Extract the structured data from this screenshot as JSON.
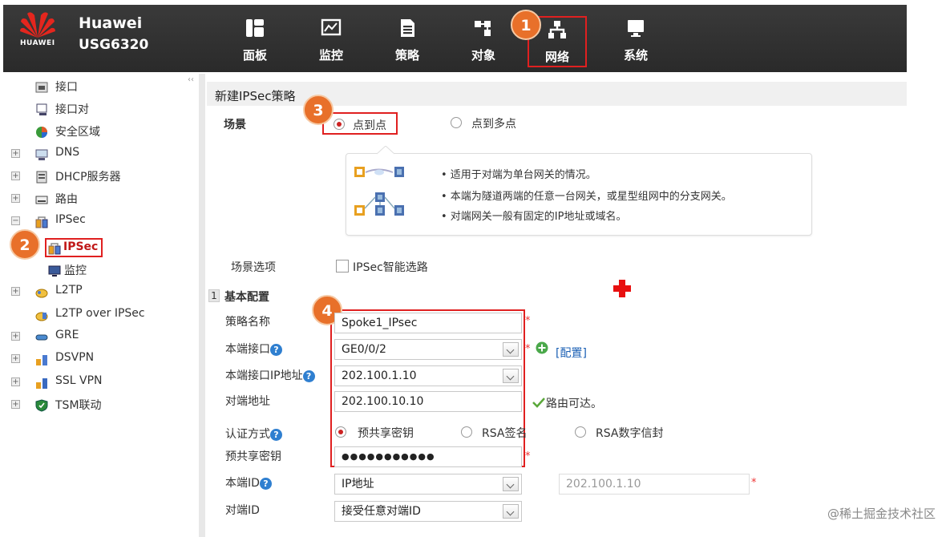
{
  "header": {
    "brand": "Huawei",
    "model": "USG6320",
    "logo_text": "HUAWEI",
    "nav": [
      {
        "label": "面板",
        "icon": "dashboard-icon"
      },
      {
        "label": "监控",
        "icon": "monitor-chart-icon"
      },
      {
        "label": "策略",
        "icon": "policy-document-icon"
      },
      {
        "label": "对象",
        "icon": "object-icon"
      },
      {
        "label": "网络",
        "icon": "network-icon",
        "highlighted": true
      },
      {
        "label": "系统",
        "icon": "system-monitor-icon"
      }
    ]
  },
  "badges": {
    "b1": "1",
    "b2": "2",
    "b3": "3",
    "b4": "4"
  },
  "sidebar": {
    "collapse": "‹‹",
    "items": [
      {
        "label": "接口",
        "icon": "interface-icon"
      },
      {
        "label": "接口对",
        "icon": "interface-pair-icon"
      },
      {
        "label": "安全区域",
        "icon": "security-zone-icon"
      },
      {
        "label": "DNS",
        "icon": "dns-icon",
        "expander": "+"
      },
      {
        "label": "DHCP服务器",
        "icon": "dhcp-server-icon",
        "expander": "+"
      },
      {
        "label": "路由",
        "icon": "router-icon",
        "expander": "+"
      },
      {
        "label": "IPSec",
        "icon": "ipsec-icon",
        "expander": "−"
      },
      {
        "label": "IPSec",
        "icon": "ipsec-icon",
        "selected": true
      },
      {
        "label": "监控",
        "icon": "monitor-icon"
      },
      {
        "label": "L2TP",
        "icon": "l2tp-icon",
        "expander": "+"
      },
      {
        "label": "L2TP over IPSec",
        "icon": "l2tp-ipsec-icon"
      },
      {
        "label": "GRE",
        "icon": "gre-icon",
        "expander": "+"
      },
      {
        "label": "DSVPN",
        "icon": "dsvpn-icon",
        "expander": "+"
      },
      {
        "label": "SSL VPN",
        "icon": "sslvpn-icon",
        "expander": "+"
      },
      {
        "label": "TSM联动",
        "icon": "tsm-shield-icon",
        "expander": "+"
      }
    ]
  },
  "main": {
    "title": "新建IPSec策略",
    "scene": {
      "label": "场景",
      "options": [
        {
          "label": "点到点",
          "selected": true
        },
        {
          "label": "点到多点",
          "selected": false
        }
      ]
    },
    "info": {
      "bullets": [
        "• 适用于对端为单台网关的情况。",
        "• 本端为隧道两端的任意一台网关，或星型组网中的分支网关。",
        "• 对端网关一般有固定的IP地址或域名。"
      ]
    },
    "scene_option": {
      "label": "场景选项",
      "checkbox_label": "IPSec智能选路",
      "checked": false
    },
    "section": {
      "number": "1",
      "title": "基本配置"
    },
    "form": {
      "policy_name": {
        "label": "策略名称",
        "value": "Spoke1_IPsec"
      },
      "local_interface": {
        "label": "本端接口",
        "value": "GE0/0/2",
        "config_link": "[配置]"
      },
      "local_ip": {
        "label": "本端接口IP地址",
        "value": "202.100.1.10"
      },
      "peer_address": {
        "label": "对端地址",
        "value": "202.100.10.10",
        "status": "路由可达。"
      },
      "auth": {
        "label": "认证方式",
        "options": [
          {
            "label": "预共享密钥",
            "selected": true
          },
          {
            "label": "RSA签名",
            "selected": false
          },
          {
            "label": "RSA数字信封",
            "selected": false
          }
        ]
      },
      "psk": {
        "label": "预共享密钥",
        "value": "●●●●●●●●●●●"
      },
      "local_id": {
        "label": "本端ID",
        "value": "IP地址",
        "extra_value": "202.100.1.10"
      },
      "peer_id": {
        "label": "对端ID",
        "value": "接受任意对端ID"
      }
    },
    "required_mark": "*",
    "help_mark": "?"
  },
  "watermark": "@稀土掘金技术社区",
  "colors": {
    "header": "#2e2e2e",
    "highlight": "#e02020",
    "badge": "#e8702a",
    "link": "#1a5fb4"
  }
}
